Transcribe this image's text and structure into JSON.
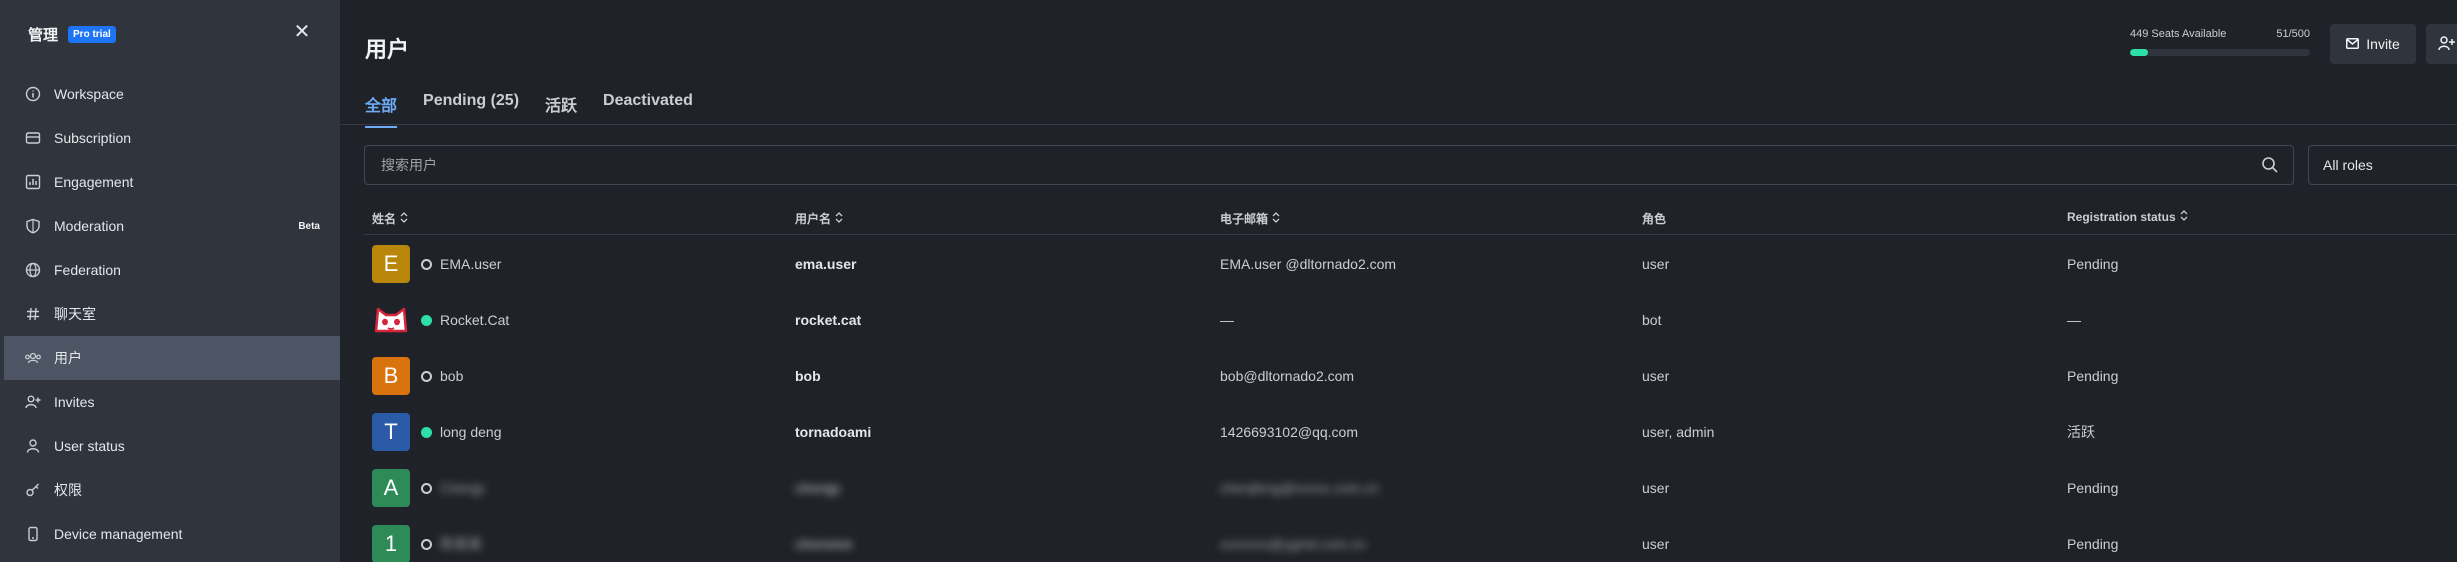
{
  "sidebar": {
    "title": "管理",
    "badge": "Pro trial",
    "items": [
      {
        "label": "Workspace",
        "icon": "info-circle-icon"
      },
      {
        "label": "Subscription",
        "icon": "card-icon"
      },
      {
        "label": "Engagement",
        "icon": "bar-chart-icon"
      },
      {
        "label": "Moderation",
        "icon": "shield-icon",
        "tag": "Beta"
      },
      {
        "label": "Federation",
        "icon": "globe-icon"
      },
      {
        "label": "聊天室",
        "icon": "hashtag-icon"
      },
      {
        "label": "用户",
        "icon": "team-icon",
        "active": true
      },
      {
        "label": "Invites",
        "icon": "user-plus-icon"
      },
      {
        "label": "User status",
        "icon": "user-icon"
      },
      {
        "label": "权限",
        "icon": "key-icon"
      },
      {
        "label": "Device management",
        "icon": "mobile-icon"
      }
    ]
  },
  "header": {
    "title": "用户",
    "seats_label": "449 Seats Available",
    "seats_count": "51/500",
    "seats_fraction": 0.102,
    "invite_label": "Invite"
  },
  "tabs": [
    {
      "label": "全部",
      "active": true
    },
    {
      "label": "Pending (25)"
    },
    {
      "label": "活跃"
    },
    {
      "label": "Deactivated"
    }
  ],
  "search": {
    "placeholder": "搜索用户"
  },
  "roles_filter": {
    "value": "All roles"
  },
  "table": {
    "columns": [
      "姓名",
      "用户名",
      "电子邮箱",
      "角色",
      "Registration status"
    ],
    "rows": [
      {
        "avatar": "E",
        "avatar_color": "#b8860b",
        "status": "offline",
        "name": "EMA.user",
        "username": "ema.user",
        "email": "EMA.user @dltornado2.com",
        "role": "user",
        "reg": "Pending"
      },
      {
        "avatar": "cat",
        "avatar_color": "#ffffff",
        "status": "online",
        "name": "Rocket.Cat",
        "username": "rocket.cat",
        "email": "—",
        "role": "bot",
        "reg": "—"
      },
      {
        "avatar": "B",
        "avatar_color": "#d9730d",
        "status": "offline",
        "name": "bob",
        "username": "bob",
        "email": "bob@dltornado2.com",
        "role": "user",
        "reg": "Pending"
      },
      {
        "avatar": "T",
        "avatar_color": "#2b5aa6",
        "status": "online",
        "name": "long deng",
        "username": "tornadoami",
        "email": "1426693102@qq.com",
        "role": "user, admin",
        "reg": "活跃"
      },
      {
        "avatar": "A",
        "avatar_color": "#2e8b57",
        "status": "offline",
        "name": "Chenjp",
        "username": "chenjp",
        "email": "chenjfeng@xxxxx.com.cn",
        "role": "user",
        "reg": "Pending"
      },
      {
        "avatar": "1",
        "avatar_color": "#2e8b57",
        "status": "offline",
        "name": "陈某某",
        "username": "chenmm",
        "email": "xxxxxxx@ygind.com.cn",
        "role": "user",
        "reg": "Pending"
      }
    ]
  }
}
